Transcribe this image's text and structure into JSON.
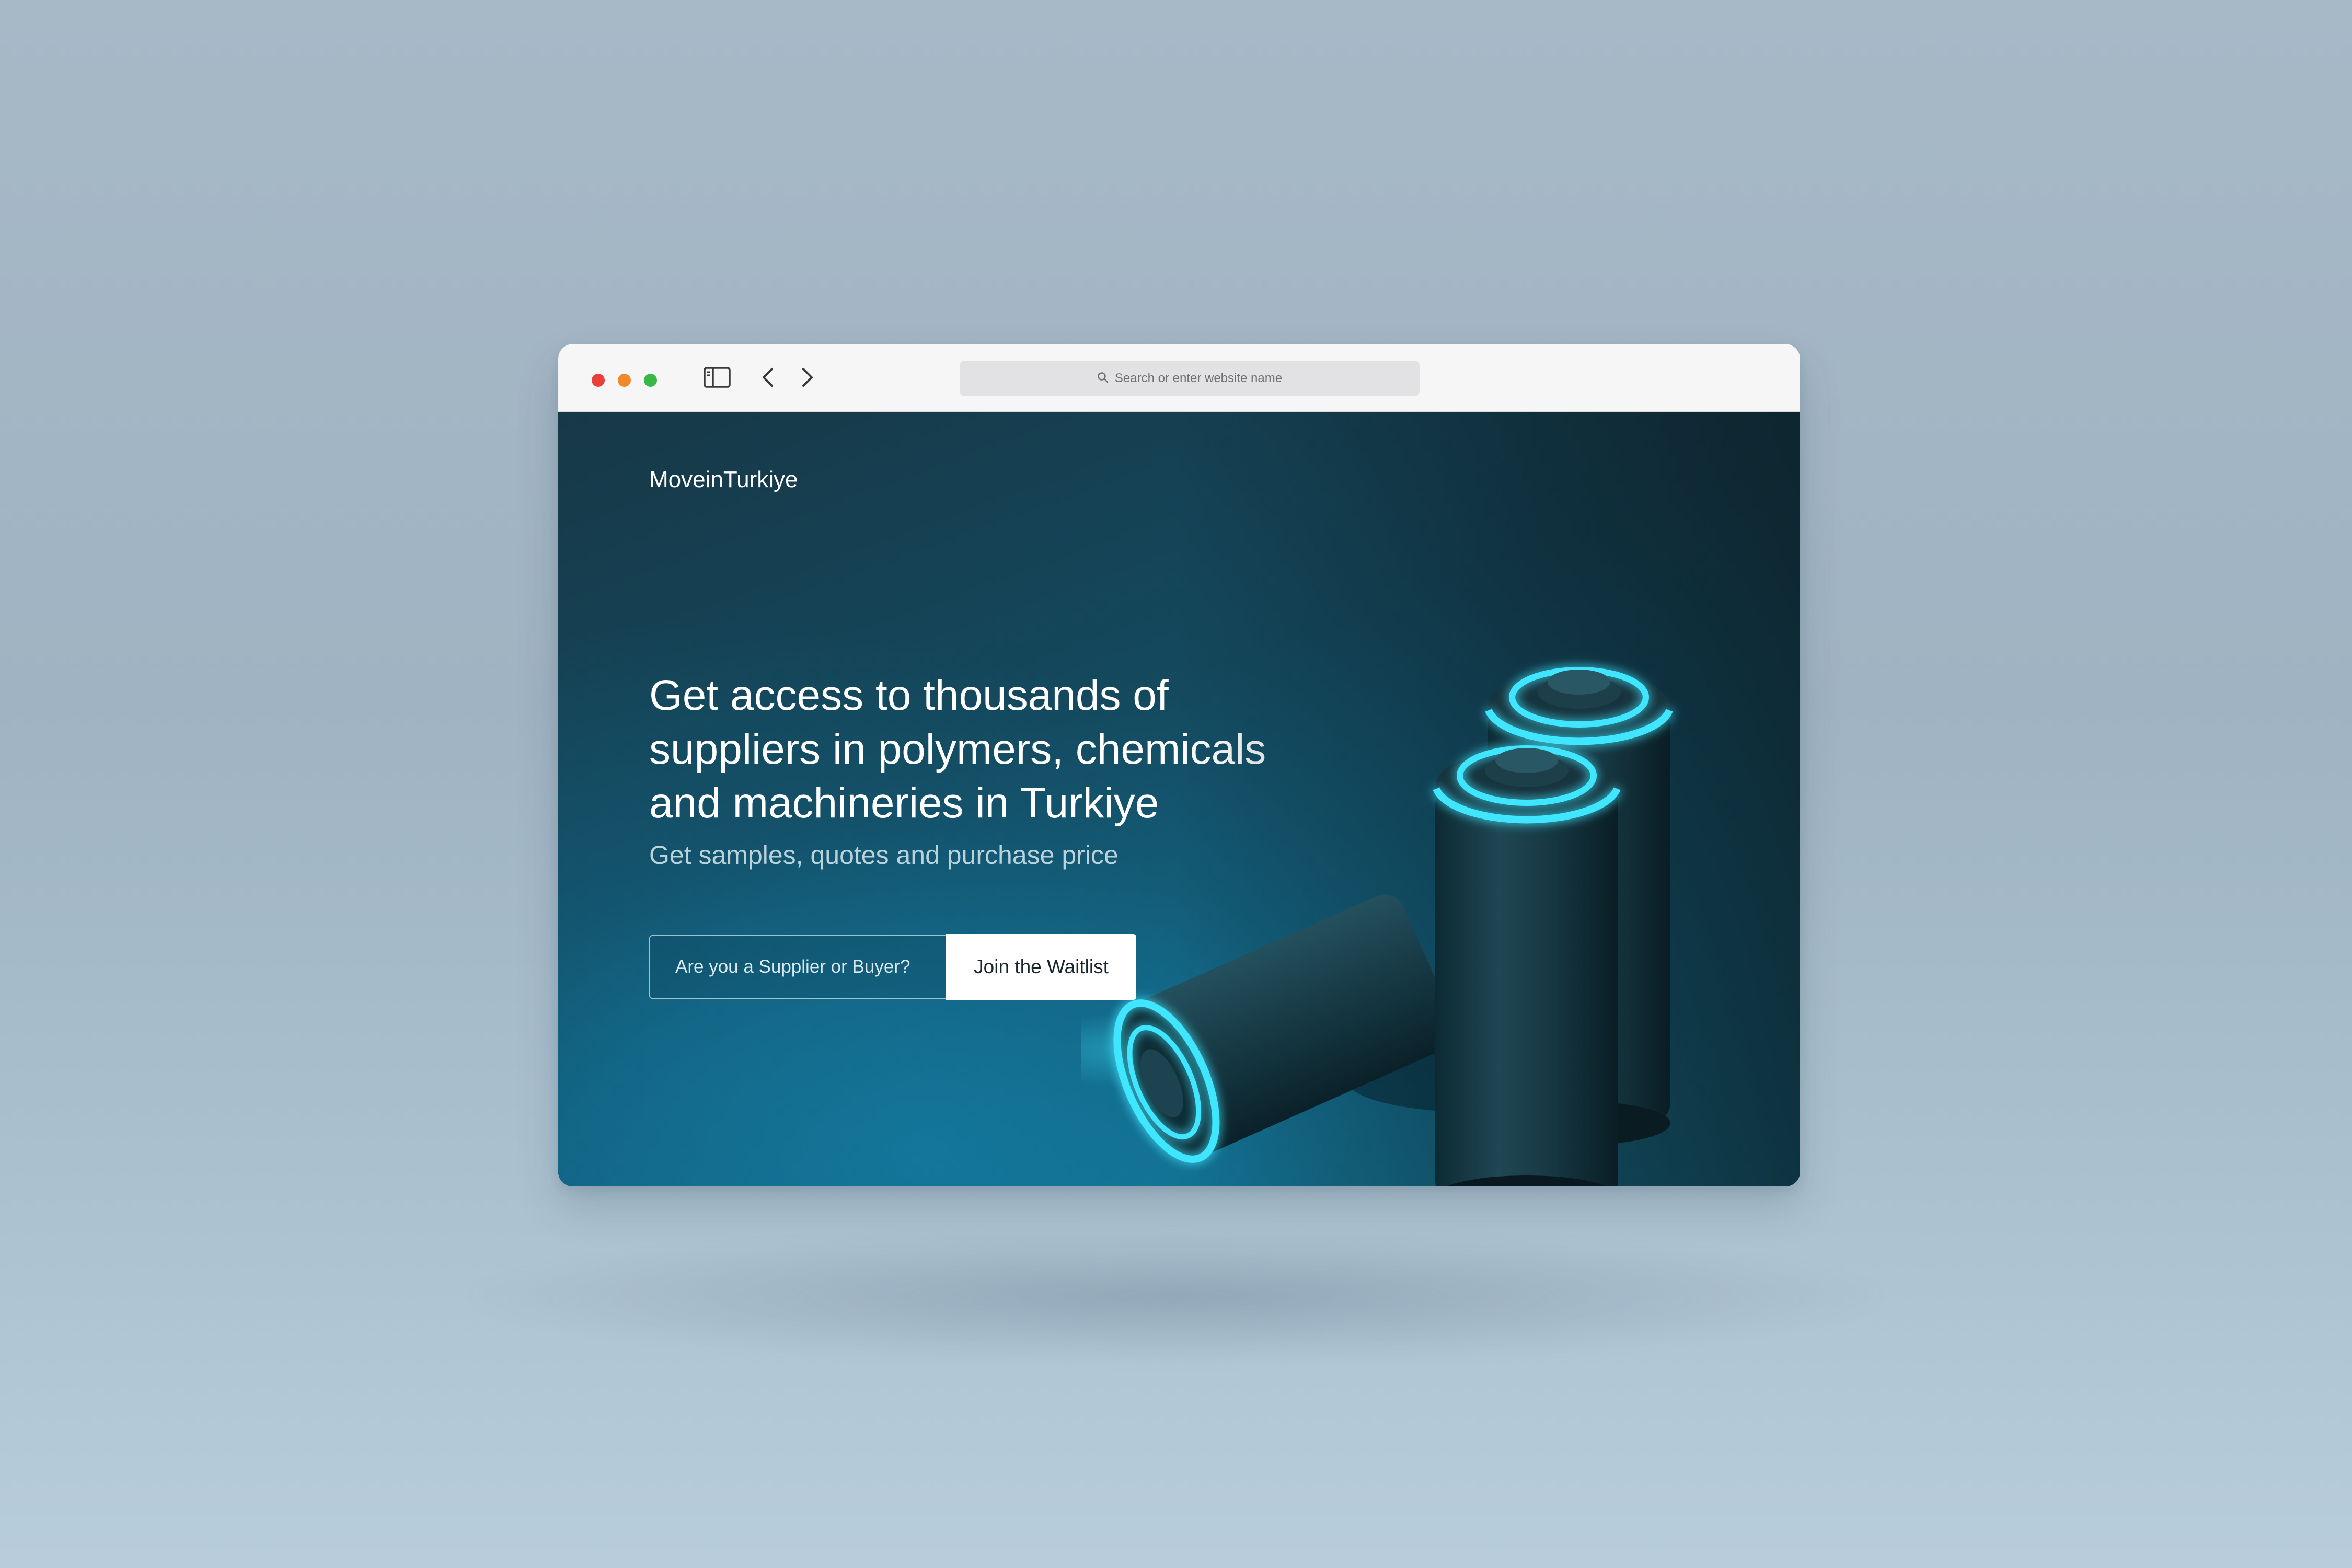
{
  "browser": {
    "window_controls": [
      "close",
      "minimize",
      "zoom"
    ],
    "url_placeholder": "Search or enter website name",
    "icons": {
      "sidebar": "sidebar-icon",
      "back": "chevron-left-icon",
      "forward": "chevron-right-icon",
      "search": "search-icon",
      "new_tab": "plus-icon",
      "tabs": "tabs-overview-icon"
    }
  },
  "page": {
    "logo": "MoveinTurkiye",
    "headline": "Get access to thousands of suppliers in polymers, chemicals and machineries in Turkiye",
    "subheadline": "Get samples, quotes and purchase price",
    "form": {
      "field_text": "Are you a Supplier or Buyer?",
      "cta_label": "Join the Waitlist"
    },
    "hero_image": "glowing-batteries"
  },
  "colors": {
    "accent_glow": "#3fe6ff",
    "page_bg_dark": "#173847",
    "page_bg_light": "#167fa0",
    "button_bg": "#ffffff"
  }
}
